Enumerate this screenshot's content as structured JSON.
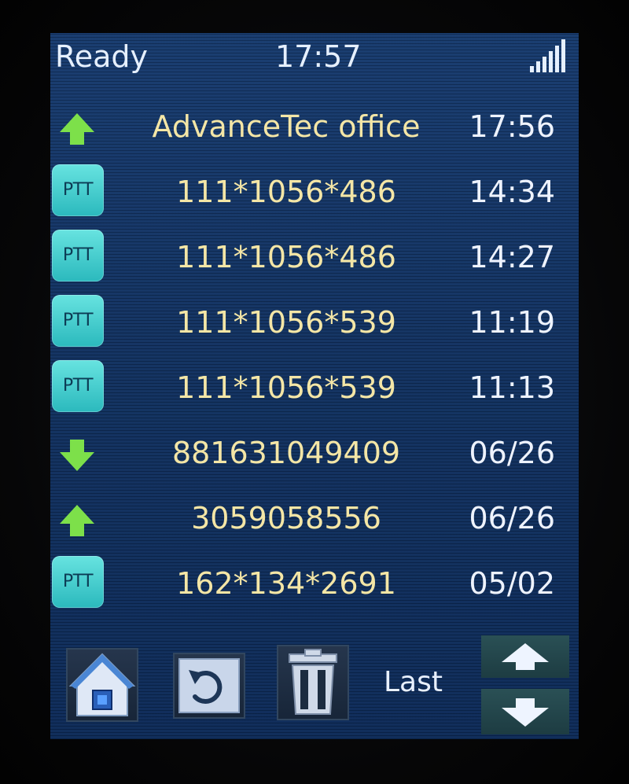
{
  "status": {
    "state": "Ready",
    "clock": "17:57",
    "signal_icon": "signal-strength-icon"
  },
  "calls": [
    {
      "type": "outgoing",
      "icon": "outgoing-arrow-icon",
      "name": "AdvanceTec office",
      "time": "17:56"
    },
    {
      "type": "ptt",
      "icon": "ptt-icon",
      "badge": "PTT",
      "name": "111*1056*486",
      "time": "14:34"
    },
    {
      "type": "ptt",
      "icon": "ptt-icon",
      "badge": "PTT",
      "name": "111*1056*486",
      "time": "14:27"
    },
    {
      "type": "ptt",
      "icon": "ptt-icon",
      "badge": "PTT",
      "name": "111*1056*539",
      "time": "11:19"
    },
    {
      "type": "ptt",
      "icon": "ptt-icon",
      "badge": "PTT",
      "name": "111*1056*539",
      "time": "11:13"
    },
    {
      "type": "incoming",
      "icon": "incoming-arrow-icon",
      "name": "881631049409",
      "time": "06/26"
    },
    {
      "type": "outgoing",
      "icon": "outgoing-arrow-icon",
      "name": "3059058556",
      "time": "06/26"
    },
    {
      "type": "ptt",
      "icon": "ptt-icon",
      "badge": "PTT",
      "name": "162*134*2691",
      "time": "05/02"
    }
  ],
  "toolbar": {
    "home_icon": "home-icon",
    "back_icon": "back-icon",
    "delete_icon": "trash-icon",
    "last_label": "Last",
    "scroll_up_icon": "arrow-up-icon",
    "scroll_down_icon": "arrow-down-icon"
  },
  "colors": {
    "screen_bg": "#10305f",
    "name_text": "#f4e6a6",
    "time_text": "#eef3ff",
    "ptt_badge": "#3ccbcc",
    "arrow_green": "#7de04a"
  }
}
